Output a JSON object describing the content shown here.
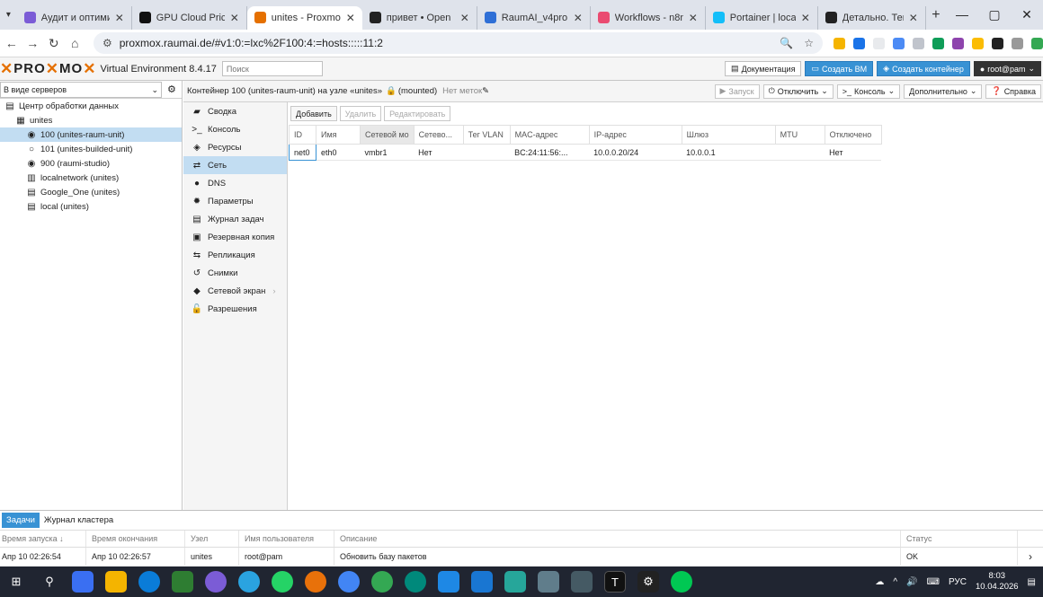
{
  "browser": {
    "tabs": [
      {
        "label": "Аудит и оптими",
        "color": "#7b5cd6",
        "active": false
      },
      {
        "label": "GPU Cloud Prici",
        "color": "#111111",
        "active": false
      },
      {
        "label": "unites - Proxmo",
        "color": "#e57000",
        "active": true
      },
      {
        "label": "привет • Open",
        "color": "#222222",
        "active": false
      },
      {
        "label": "RaumAI_v4pro |",
        "color": "#2f6fd6",
        "active": false
      },
      {
        "label": "Workflows - n8n",
        "color": "#ea4b71",
        "active": false
      },
      {
        "label": "Portainer | local",
        "color": "#13bef9",
        "active": false
      },
      {
        "label": "Детально. Тема",
        "color": "#222222",
        "active": false
      }
    ],
    "url": "proxmox.raumai.de/#v1:0:=lxc%2F100:4:=hosts:::::11:2"
  },
  "pve": {
    "brand_left": "PRO",
    "brand_right": "MO",
    "product": "Virtual Environment 8.4.17",
    "search_placeholder": "Поиск",
    "buttons": {
      "docs": "Документация",
      "create_vm": "Создать ВМ",
      "create_ct": "Создать контейнер",
      "user": "root@pam"
    }
  },
  "tree": {
    "view": "В виде серверов",
    "items": [
      {
        "label": "Центр обработки данных",
        "icon": "datacenter-icon",
        "indent": 0,
        "selected": false
      },
      {
        "label": "unites",
        "icon": "node-icon",
        "indent": 1,
        "selected": false
      },
      {
        "label": "100 (unites-raum-unit)",
        "icon": "container-icon",
        "indent": 2,
        "selected": true
      },
      {
        "label": "101 (unites-builded-unit)",
        "icon": "container-stopped-icon",
        "indent": 2,
        "selected": false
      },
      {
        "label": "900 (raumi-studio)",
        "icon": "container-icon",
        "indent": 2,
        "selected": false
      },
      {
        "label": "localnetwork (unites)",
        "icon": "network-icon",
        "indent": 2,
        "selected": false
      },
      {
        "label": "Google_One (unites)",
        "icon": "storage-icon",
        "indent": 2,
        "selected": false
      },
      {
        "label": "local (unites)",
        "icon": "storage-icon",
        "indent": 2,
        "selected": false
      }
    ]
  },
  "header": {
    "title": "Контейнер 100 (unites-raum-unit) на узле «unites»",
    "mounted": "(mounted)",
    "notags": "Нет меток",
    "start": "Запуск",
    "shutdown": "Отключить",
    "console": "Консоль",
    "more": "Дополнительно",
    "help": "Справка"
  },
  "menu": [
    {
      "label": "Сводка",
      "icon": "book-icon",
      "selected": false
    },
    {
      "label": "Консоль",
      "icon": "terminal-icon",
      "selected": false
    },
    {
      "label": "Ресурсы",
      "icon": "cube-icon",
      "selected": false
    },
    {
      "label": "Сеть",
      "icon": "exchange-icon",
      "selected": true
    },
    {
      "label": "DNS",
      "icon": "globe-icon",
      "selected": false
    },
    {
      "label": "Параметры",
      "icon": "gear-icon",
      "selected": false
    },
    {
      "label": "Журнал задач",
      "icon": "list-icon",
      "selected": false
    },
    {
      "label": "Резервная копия",
      "icon": "floppy-icon",
      "selected": false
    },
    {
      "label": "Репликация",
      "icon": "retweet-icon",
      "selected": false
    },
    {
      "label": "Снимки",
      "icon": "history-icon",
      "selected": false
    },
    {
      "label": "Сетевой экран",
      "icon": "shield-icon",
      "selected": false
    },
    {
      "label": "Разрешения",
      "icon": "unlock-icon",
      "selected": false
    }
  ],
  "toolbar": {
    "add": "Добавить",
    "remove": "Удалить",
    "edit": "Редактировать"
  },
  "grid": {
    "columns": [
      "ID",
      "Имя",
      "Сетевой мо",
      "Сетево...",
      "Тег VLAN",
      "MAC-адрес",
      "IP-адрес",
      "Шлюз",
      "MTU",
      "Отключено"
    ],
    "rows": [
      [
        "net0",
        "eth0",
        "vmbr1",
        "Нет",
        "",
        "BC:24:11:56:...",
        "10.0.0.20/24",
        "10.0.0.1",
        "",
        "Нет"
      ]
    ]
  },
  "tasks": {
    "tabs": [
      "Задачи",
      "Журнал кластера"
    ],
    "columns": [
      "Время запуска ↓",
      "Время окончания",
      "Узел",
      "Имя пользователя",
      "Описание",
      "Статус"
    ],
    "rows": [
      [
        "Апр 10 02:26:54",
        "Апр 10 02:26:57",
        "unites",
        "root@pam",
        "Обновить базу пакетов",
        "OK"
      ]
    ]
  },
  "taskbar": {
    "lang": "РУС",
    "time": "8:03",
    "date": "10.04.2026"
  }
}
